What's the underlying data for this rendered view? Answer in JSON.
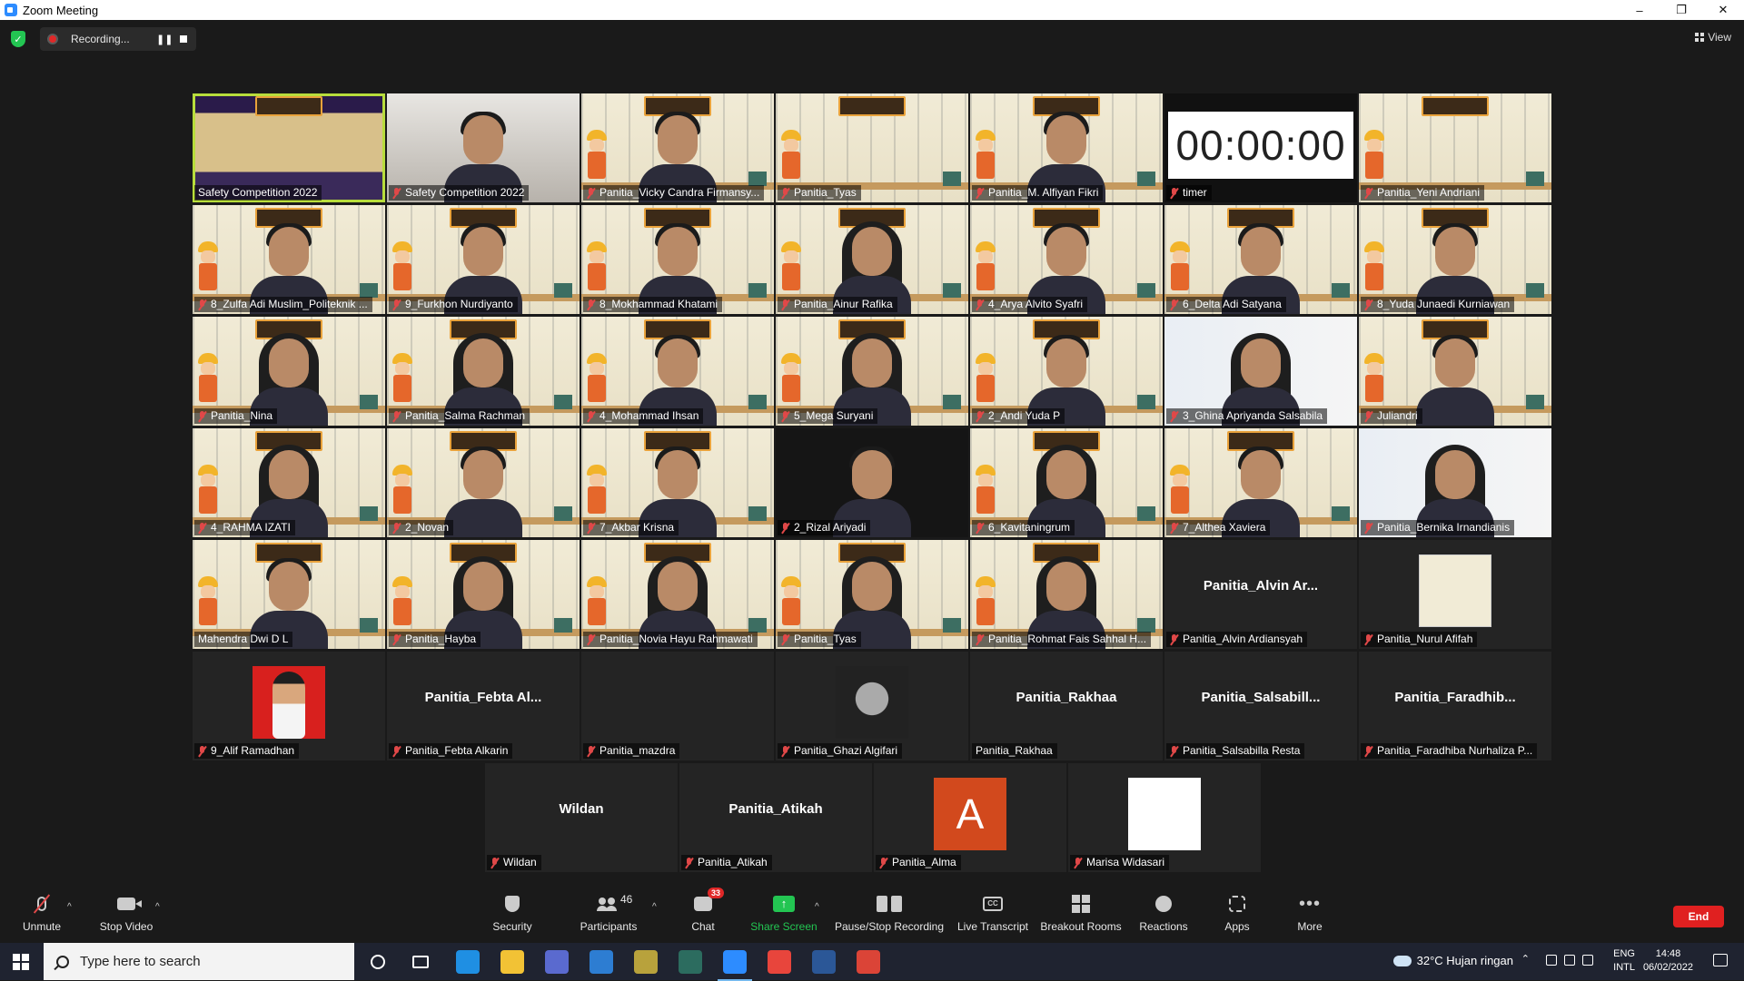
{
  "window": {
    "title": "Zoom Meeting",
    "minimize": "–",
    "restore": "❐",
    "close": "✕"
  },
  "top_bar": {
    "recording_text": "Recording...",
    "view_label": "View"
  },
  "participants": [
    {
      "name": "Safety Competition 2022",
      "type": "stage",
      "active": true,
      "muted": false
    },
    {
      "name": "Safety Competition 2022",
      "type": "room",
      "muted": true
    },
    {
      "name": "Panitia_Vicky Candra Firmansy...",
      "type": "vbg",
      "muted": true
    },
    {
      "name": "Panitia_Tyas",
      "type": "vbg-empty",
      "muted": true
    },
    {
      "name": "Panitia_M. Alfiyan Fikri",
      "type": "vbg",
      "muted": true
    },
    {
      "name": "timer",
      "type": "timer",
      "timer": "00:00:00",
      "muted": true
    },
    {
      "name": "Panitia_Yeni Andriani",
      "type": "vbg-empty",
      "muted": true
    },
    {
      "name": "8_Zulfa Adi Muslim_Politeknik ...",
      "type": "vbg",
      "muted": true
    },
    {
      "name": "9_Furkhon Nurdiyanto",
      "type": "vbg",
      "muted": true
    },
    {
      "name": "8_Mokhammad Khatami",
      "type": "vbg",
      "muted": true
    },
    {
      "name": "Panitia_Ainur Rafika",
      "type": "vbg-hijab",
      "muted": true
    },
    {
      "name": "4_Arya Alvito Syafri",
      "type": "vbg",
      "muted": true
    },
    {
      "name": "6_Delta Adi Satyana",
      "type": "vbg",
      "muted": true
    },
    {
      "name": "8_Yuda Junaedi Kurniawan",
      "type": "vbg",
      "muted": true
    },
    {
      "name": "Panitia_Nina",
      "type": "vbg-hijab",
      "muted": true
    },
    {
      "name": "Panitia_Salma Rachman",
      "type": "vbg-hijab",
      "muted": true
    },
    {
      "name": "4_Mohammad Ihsan",
      "type": "vbg",
      "muted": true
    },
    {
      "name": "5_Mega Suryani",
      "type": "vbg-hijab",
      "muted": true
    },
    {
      "name": "2_Andi Yuda P",
      "type": "vbg",
      "muted": true
    },
    {
      "name": "3_Ghina Apriyanda Salsabila",
      "type": "plain-hijab",
      "muted": true
    },
    {
      "name": "Juliandri",
      "type": "vbg",
      "muted": true
    },
    {
      "name": "4_RAHMA IZATI",
      "type": "vbg-hijab",
      "muted": true
    },
    {
      "name": "2_Novan",
      "type": "vbg",
      "muted": true
    },
    {
      "name": "7_Akbar Krisna",
      "type": "vbg",
      "muted": true
    },
    {
      "name": "2_Rizal Ariyadi",
      "type": "dark-person",
      "muted": true
    },
    {
      "name": "6_Kavitaningrum",
      "type": "vbg-hijab",
      "muted": true
    },
    {
      "name": "7_Althea Xaviera",
      "type": "vbg",
      "muted": true
    },
    {
      "name": "Panitia_Bernika Irnandianis",
      "type": "plain-hijab",
      "muted": true
    },
    {
      "name": "Mahendra Dwi D L",
      "type": "vbg",
      "muted": false
    },
    {
      "name": "Panitia_Hayba",
      "type": "vbg-hijab",
      "muted": true
    },
    {
      "name": "Panitia_Novia Hayu Rahmawati",
      "type": "vbg-hijab",
      "muted": true
    },
    {
      "name": "Panitia_Tyas",
      "type": "vbg-hijab",
      "muted": true
    },
    {
      "name": "Panitia_Rohmat Fais Sahhal H...",
      "type": "vbg-hijab",
      "muted": true
    },
    {
      "name": "Panitia_Alvin Ardiansyah",
      "display": "Panitia_Alvin  Ar...",
      "type": "name",
      "muted": true
    },
    {
      "name": "Panitia_Nurul Afifah",
      "type": "logo",
      "muted": true
    },
    {
      "name": "9_Alif Ramadhan",
      "type": "avatar-red",
      "muted": true
    },
    {
      "name": "Panitia_Febta Alkarin",
      "display": "Panitia_Febta  Al...",
      "type": "name",
      "muted": true
    },
    {
      "name": "Panitia_mazdra",
      "type": "empty",
      "muted": true
    },
    {
      "name": "Panitia_Ghazi Algifari",
      "type": "avatar-bw",
      "muted": true
    },
    {
      "name": "Panitia_Rakhaa",
      "display": "Panitia_Rakhaa",
      "type": "name",
      "muted": false
    },
    {
      "name": "Panitia_Salsabilla Resta",
      "display": "Panitia_Salsabill...",
      "type": "name",
      "muted": true
    },
    {
      "name": "Panitia_Faradhiba Nurhaliza P...",
      "display": "Panitia_Faradhib...",
      "type": "name",
      "muted": true
    },
    {
      "name": "Wildan",
      "display": "Wildan",
      "type": "name",
      "muted": true
    },
    {
      "name": "Panitia_Atikah",
      "display": "Panitia_Atikah",
      "type": "name",
      "muted": true
    },
    {
      "name": "Panitia_Alma",
      "type": "avatar-letter",
      "letter": "A",
      "muted": true
    },
    {
      "name": "Marisa Widasari",
      "type": "avatar-white",
      "muted": true
    }
  ],
  "toolbar": {
    "unmute": "Unmute",
    "stop_video": "Stop Video",
    "security": "Security",
    "participants": "Participants",
    "participants_count": "46",
    "chat": "Chat",
    "chat_badge": "33",
    "share_screen": "Share Screen",
    "pause_stop_recording": "Pause/Stop Recording",
    "live_transcript": "Live Transcript",
    "breakout_rooms": "Breakout Rooms",
    "reactions": "Reactions",
    "apps": "Apps",
    "more": "More",
    "end": "End",
    "cc_glyph": "CC",
    "share_glyph": "↑",
    "more_glyph": "•••",
    "caret_glyph": "^"
  },
  "taskbar": {
    "search_placeholder": "Type here to search",
    "weather": "32°C  Hujan ringan",
    "lang_1": "ENG",
    "lang_2": "INTL",
    "time": "14:48",
    "date": "06/02/2022",
    "apps": [
      "edge-icon",
      "file-explorer-icon",
      "store-icon",
      "mail-icon",
      "app-ndi-icon",
      "app-ndi-2-icon",
      "zoom-icon",
      "chrome-icon",
      "word-icon",
      "chrome-alt-icon"
    ]
  },
  "colors": {
    "accent_green": "#23c552",
    "end_red": "#e02020",
    "active_outline": "#b8dd3c",
    "muted_red": "#e04848"
  }
}
